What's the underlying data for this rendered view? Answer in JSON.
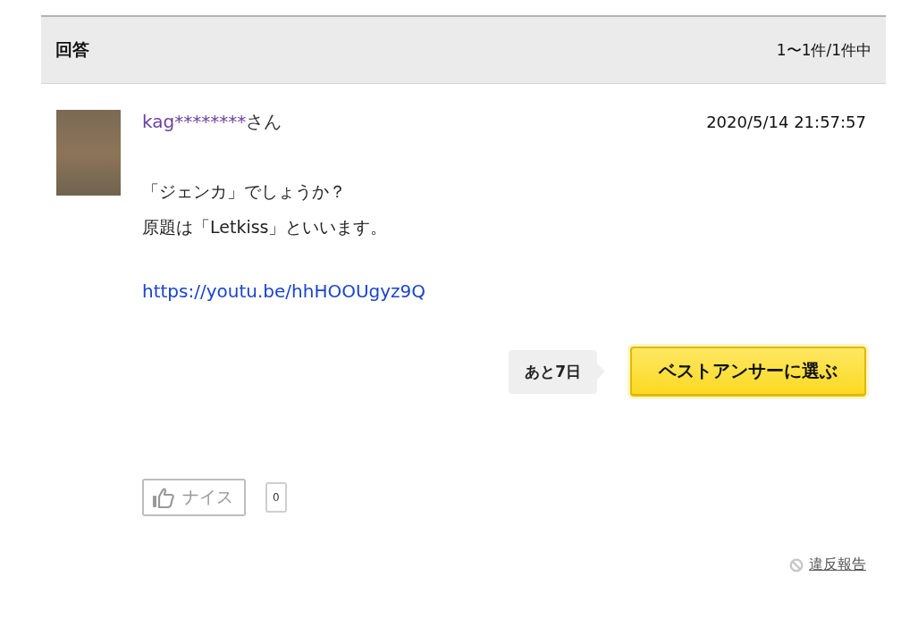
{
  "header": {
    "title": "回答",
    "count": "1〜1件/1件中"
  },
  "answer": {
    "user_name": "kag********",
    "user_suffix": "さん",
    "timestamp": "2020/5/14  21:57:57",
    "body_lines": [
      "「ジェンカ」でしょうか？",
      "原題は「Letkiss」といいます。"
    ],
    "link": "https://youtu.be/hhHOOUgyz9Q",
    "remaining": "あと7日",
    "best_answer_button": "ベストアンサーに選ぶ",
    "nice_button": {
      "label": "ナイス",
      "disabled": true
    },
    "nice_count": "0",
    "report_link": "違反報告"
  }
}
